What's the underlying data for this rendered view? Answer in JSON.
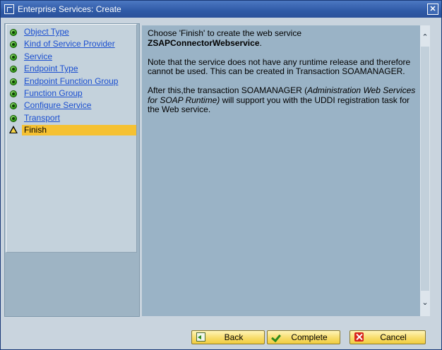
{
  "window": {
    "title": "Enterprise Services: Create",
    "close_glyph": "✕"
  },
  "steps": [
    {
      "label": "Object Type",
      "status": "done"
    },
    {
      "label": "Kind of Service Provider",
      "status": "done"
    },
    {
      "label": "Service",
      "status": "done"
    },
    {
      "label": "Endpoint Type",
      "status": "done"
    },
    {
      "label": "Endpoint Function Group",
      "status": "done"
    },
    {
      "label": "Function Group",
      "status": "done"
    },
    {
      "label": "Configure Service",
      "status": "done"
    },
    {
      "label": "Transport",
      "status": "done"
    },
    {
      "label": "Finish",
      "status": "current"
    }
  ],
  "main": {
    "p1_prefix": "Choose 'Finish' to create the web service",
    "service_name": "ZSAPConnectorWebservice",
    "p1_suffix": ".",
    "p2": "Note that the service does not have any runtime release and therefore cannot be used. This can be created in Transaction SOAMANAGER.",
    "p3_prefix": "After this,the transaction SOAMANAGER (",
    "p3_italic": "Administration Web Services for SOAP Runtime)",
    "p3_suffix": " will support you with the UDDI registration task for the Web service."
  },
  "scroll": {
    "up_glyph": "⌃",
    "down_glyph": "⌄"
  },
  "buttons": {
    "back": "Back",
    "complete": "Complete",
    "cancel": "Cancel"
  },
  "colors": {
    "title_bar": "#2f5aa6",
    "panel_bg": "#9ab3c6",
    "current_step_highlight": "#f5c132",
    "link": "#1b4fd0",
    "button_bg": "#f7dc6c"
  },
  "icons": {
    "done_step": "green-circle-icon",
    "current_step": "warning-triangle-icon",
    "back": "back-arrow-icon",
    "complete": "checkmark-icon",
    "cancel": "cancel-x-icon"
  }
}
